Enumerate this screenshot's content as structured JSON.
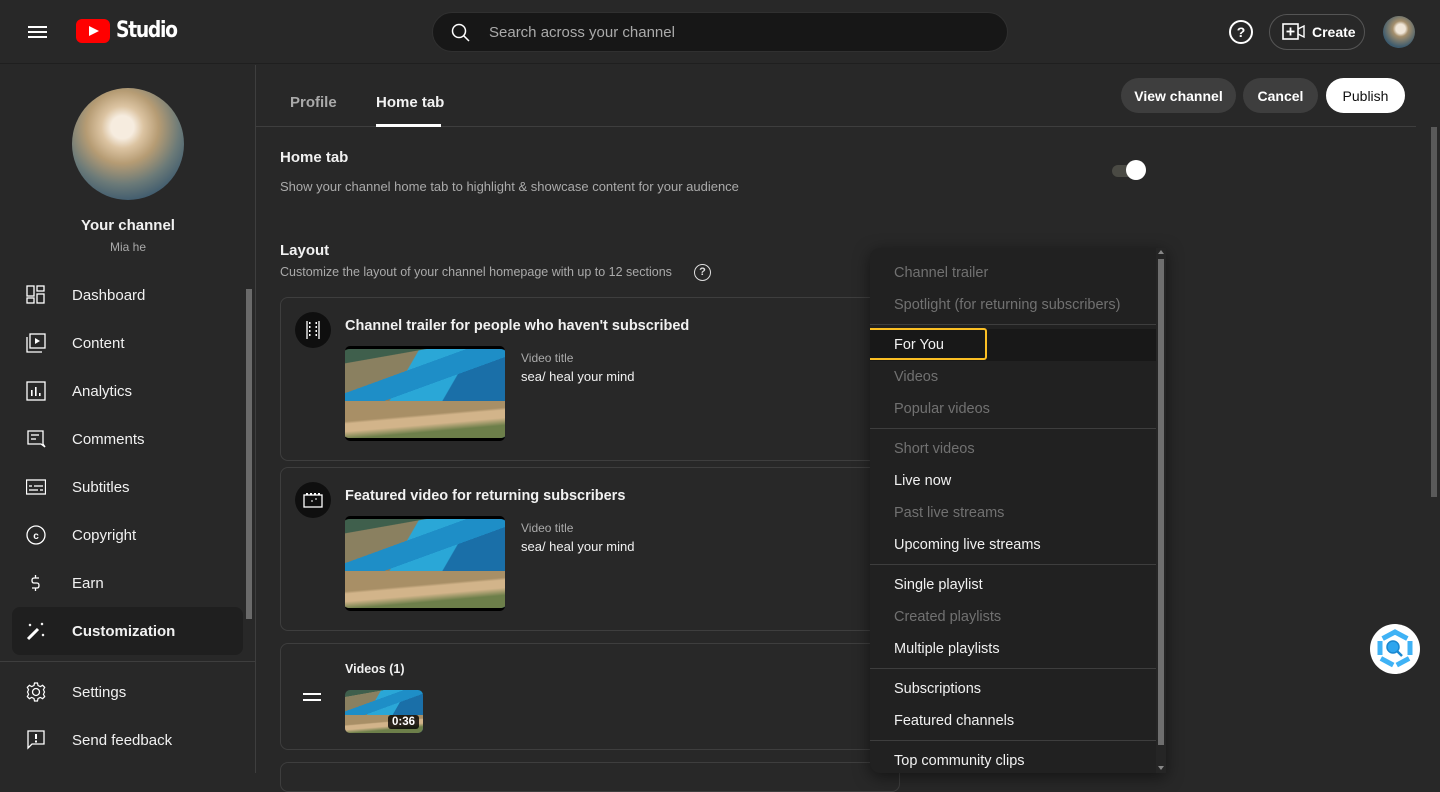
{
  "header": {
    "logo_text": "Studio",
    "search_placeholder": "Search across your channel",
    "help_glyph": "?",
    "create_label": "Create"
  },
  "sidebar": {
    "channel_title": "Your channel",
    "channel_name": "Mia he",
    "items": [
      {
        "label": "Dashboard",
        "icon": "dashboard-icon"
      },
      {
        "label": "Content",
        "icon": "content-icon"
      },
      {
        "label": "Analytics",
        "icon": "analytics-icon"
      },
      {
        "label": "Comments",
        "icon": "comments-icon"
      },
      {
        "label": "Subtitles",
        "icon": "subtitles-icon"
      },
      {
        "label": "Copyright",
        "icon": "copyright-icon"
      },
      {
        "label": "Earn",
        "icon": "dollar-icon"
      },
      {
        "label": "Customization",
        "icon": "magic-wand-icon",
        "active": true
      }
    ],
    "bottom_items": [
      {
        "label": "Settings",
        "icon": "gear-icon"
      },
      {
        "label": "Send feedback",
        "icon": "feedback-icon"
      }
    ]
  },
  "main": {
    "tabs": [
      {
        "label": "Profile",
        "active": false
      },
      {
        "label": "Home tab",
        "active": true
      }
    ],
    "actions": {
      "view_channel": "View channel",
      "cancel": "Cancel",
      "publish": "Publish"
    },
    "home_tab": {
      "title": "Home tab",
      "description": "Show your channel home tab to highlight & showcase content for your audience",
      "enabled": true
    },
    "layout": {
      "title": "Layout",
      "description": "Customize the layout of your channel homepage with up to 12 sections",
      "help_glyph": "?"
    },
    "cards": [
      {
        "title": "Channel trailer for people who haven't subscribed",
        "video_label": "Video title",
        "video_name": "sea/ heal your mind"
      },
      {
        "title": "Featured video for returning subscribers",
        "video_label": "Video title",
        "video_name": "sea/ heal your mind"
      },
      {
        "title": "Videos (1)",
        "duration": "0:36"
      }
    ]
  },
  "menu": {
    "groups": [
      [
        {
          "label": "Channel trailer",
          "enabled": false
        },
        {
          "label": "Spotlight (for returning subscribers)",
          "enabled": false
        }
      ],
      [
        {
          "label": "For You",
          "enabled": true,
          "focused": true
        },
        {
          "label": "Videos",
          "enabled": false
        },
        {
          "label": "Popular videos",
          "enabled": false
        }
      ],
      [
        {
          "label": "Short videos",
          "enabled": false
        },
        {
          "label": "Live now",
          "enabled": true
        },
        {
          "label": "Past live streams",
          "enabled": false
        },
        {
          "label": "Upcoming live streams",
          "enabled": true
        }
      ],
      [
        {
          "label": "Single playlist",
          "enabled": true
        },
        {
          "label": "Created playlists",
          "enabled": false
        },
        {
          "label": "Multiple playlists",
          "enabled": true
        }
      ],
      [
        {
          "label": "Subscriptions",
          "enabled": true
        },
        {
          "label": "Featured channels",
          "enabled": true
        }
      ],
      [
        {
          "label": "Top community clips",
          "enabled": true
        }
      ]
    ]
  },
  "colors": {
    "background": "#282828",
    "brand_red": "#ff0000",
    "focus_ring": "#fbbf24",
    "menu_bg": "#212121"
  }
}
